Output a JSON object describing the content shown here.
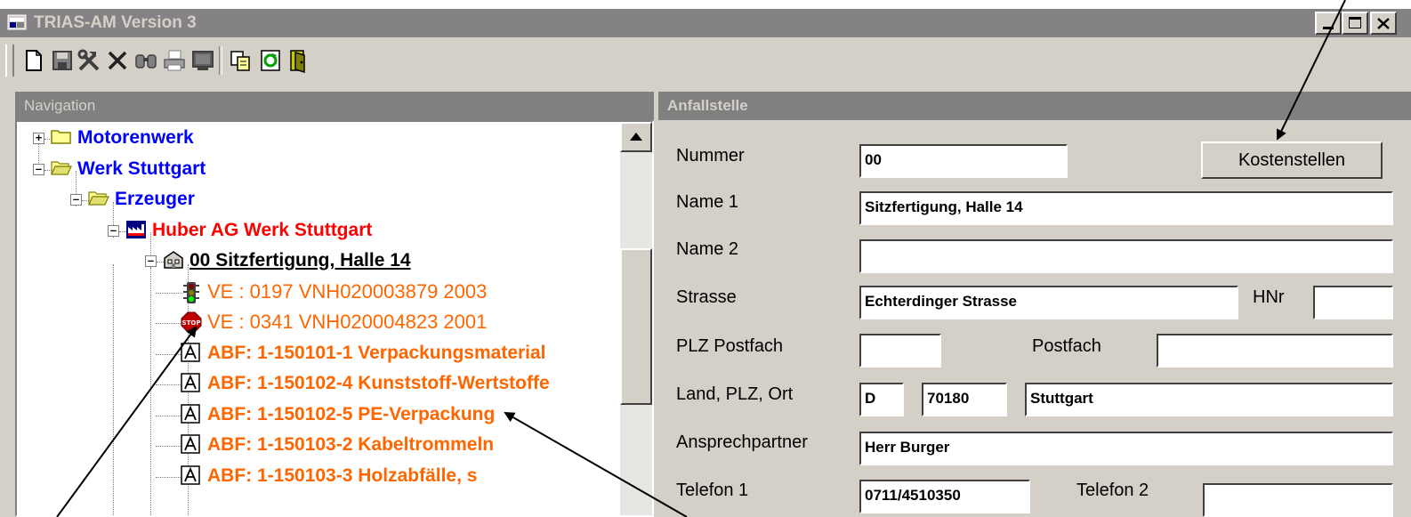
{
  "window": {
    "title": "TRIAS-AM Version 3",
    "controls": [
      "minimize-icon",
      "maximize-icon",
      "close-icon"
    ]
  },
  "toolbar": {
    "icons": [
      "new-document-icon",
      "save-icon",
      "tools-icon",
      "delete-icon",
      "search-icon",
      "print-icon",
      "monitor-icon",
      "copy-icon",
      "refresh-icon",
      "exit-icon"
    ]
  },
  "navigation": {
    "header": "Navigation",
    "tree": [
      {
        "label": "Motorenwerk",
        "color": "#0000ff",
        "icon": "folder-icon",
        "expander": "+"
      },
      {
        "label": "Werk Stuttgart",
        "color": "#0000ff",
        "icon": "folder-open-icon",
        "expander": "-"
      },
      {
        "label": "Erzeuger",
        "color": "#0000ff",
        "icon": "folder-open-icon",
        "expander": "-"
      },
      {
        "label": "Huber AG Werk Stuttgart",
        "color": "#ff0000",
        "icon": "factory-icon",
        "expander": "-"
      },
      {
        "label": "00 Sitzfertigung, Halle 14",
        "color": "#000000",
        "icon": "building-icon",
        "expander": "-"
      },
      {
        "label": "VE : 0197  VNH020003879 2003",
        "color": "#ff6600",
        "icon": "traffic-light-icon"
      },
      {
        "label": "VE : 0341  VNH020004823 2001",
        "color": "#ff6600",
        "icon": "stop-sign-icon"
      },
      {
        "label": "ABF: 1-150101-1 Verpackungsmaterial",
        "color": "#ff6600",
        "icon": "letter-a-icon"
      },
      {
        "label": "ABF: 1-150102-4 Kunststoff-Wertstoffe",
        "color": "#ff6600",
        "icon": "letter-a-icon"
      },
      {
        "label": "ABF: 1-150102-5 PE-Verpackung",
        "color": "#ff6600",
        "icon": "letter-a-icon"
      },
      {
        "label": "ABF: 1-150103-2 Kabeltrommeln",
        "color": "#ff6600",
        "icon": "letter-a-icon"
      },
      {
        "label": "ABF: 1-150103-3 Holzabfälle, s",
        "color": "#ff6600",
        "icon": "letter-a-icon"
      }
    ]
  },
  "form": {
    "header": "Anfallstelle",
    "kostenstellen_button": "Kostenstellen",
    "labels": {
      "nummer": "Nummer",
      "name1": "Name 1",
      "name2": "Name 2",
      "strasse": "Strasse",
      "hnr": "HNr",
      "plz_postfach": "PLZ Postfach",
      "postfach": "Postfach",
      "land_plz_ort": "Land, PLZ, Ort",
      "ansprechpartner": "Ansprechpartner",
      "telefon1": "Telefon 1",
      "telefon2": "Telefon 2"
    },
    "values": {
      "nummer": "00",
      "name1": "Sitzfertigung, Halle 14",
      "name2": "",
      "strasse": "Echterdinger Strasse",
      "hnr": "",
      "plz_postfach": "",
      "postfach": "",
      "land": "D",
      "plz": "70180",
      "ort": "Stuttgart",
      "ansprechpartner": "Herr Burger",
      "telefon1": "0711/4510350",
      "telefon2": ""
    }
  }
}
